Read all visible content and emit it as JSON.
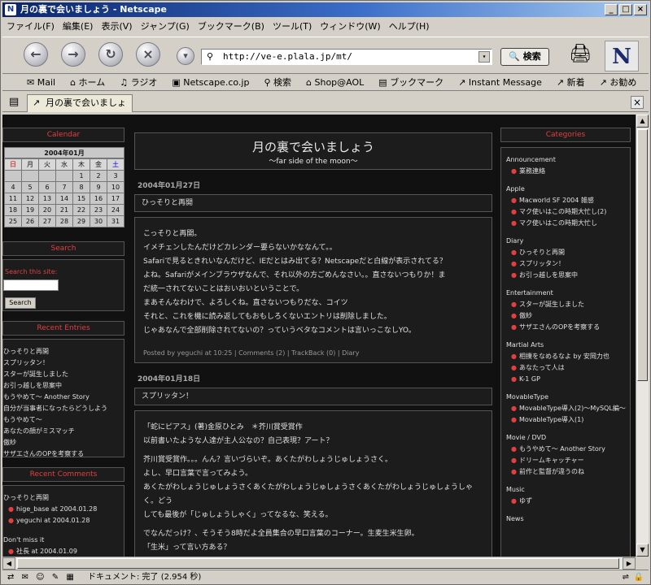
{
  "window": {
    "title": "月の裏で会いましょう - Netscape"
  },
  "menu": [
    "ファイル(F)",
    "編集(E)",
    "表示(V)",
    "ジャンプ(G)",
    "ブックマーク(B)",
    "ツール(T)",
    "ウィンドウ(W)",
    "ヘルプ(H)"
  ],
  "nav": {
    "url": "http://ve-e.plala.jp/mt/",
    "search_label": "検索"
  },
  "bookmarks": [
    "Mail",
    "ホーム",
    "ラジオ",
    "Netscape.co.jp",
    "検索",
    "Shop@AOL",
    "ブックマーク",
    "Instant Message",
    "新着",
    "お勧め"
  ],
  "tab": {
    "label": "月の裏で会いましょう"
  },
  "blog": {
    "title": "月の裏で会いましょう",
    "subtitle": "〜far side of the moon〜",
    "calendar": {
      "heading": "Calendar",
      "month": "2004年01月",
      "weekdays": [
        "日",
        "月",
        "火",
        "水",
        "木",
        "金",
        "土"
      ],
      "rows": [
        [
          "",
          "",
          "",
          "",
          "1",
          "2",
          "3"
        ],
        [
          "4",
          "5",
          "6",
          "7",
          "8",
          "9",
          "10"
        ],
        [
          "11",
          "12",
          "13",
          "14",
          "15",
          "16",
          "17"
        ],
        [
          "18",
          "19",
          "20",
          "21",
          "22",
          "23",
          "24"
        ],
        [
          "25",
          "26",
          "27",
          "28",
          "29",
          "30",
          "31"
        ]
      ]
    },
    "search": {
      "heading": "Search",
      "label": "Search this site:",
      "button": "Search"
    },
    "recent_entries": {
      "heading": "Recent Entries",
      "items": [
        "ひっそりと再開",
        "スプリッタン！",
        "スターが誕生しました",
        "お引っ越しを思案中",
        "もうやめて〜 Another Story",
        "自分が当事者になったらどうしよう",
        "もうやめて〜",
        "あなたの顔がミスマッチ",
        "傲紗",
        "サザエさんのOPを考察する"
      ]
    },
    "recent_comments": {
      "heading": "Recent Comments",
      "groups": [
        {
          "title": "ひっそりと再開",
          "items": [
            "hige_base  at 2004.01.28",
            "yeguchi  at 2004.01.28"
          ]
        },
        {
          "title": "Don't miss it",
          "items": [
            "社長  at 2004.01.09"
          ]
        }
      ]
    },
    "posts": [
      {
        "date": "2004年01月27日",
        "title": "ひっそりと再開",
        "lines": [
          "こっそりと再開。",
          "イメチェンしたんだけどカレンダー要らないかななんて。。",
          "Safariで見るときれいなんだけど、IEだとはみ出てる？Netscapeだと白線が表示されてる？",
          "よね。Safariがメインブラウザなんで、それ以外の方ごめんなさい。。直さないつもりか！ま",
          "だ統一されてないことはおいおいということで。",
          "まあそんなわけで、よろしくね。直さないつもりだな、コイツ",
          "それと、これを機に読み返してもおもしろくないエントリは削除しました。",
          "じゃあなんで全部削除されてないの？っていうベタなコメントは言いっこなしYO。"
        ],
        "footer": "Posted by yeguchi at 10:25 | Comments (2) | TrackBack (0) | Diary"
      },
      {
        "date": "2004年01月18日",
        "title": "スプリッタン！",
        "lines": [
          "「蛇にピアス」(著)金原ひとみ　＊芥川賞受賞作",
          "以前書いたような人達が主人公なの？自己表現？アート？",
          "",
          "芥川賞受賞作。。。んん？言いづらいぞ。あくたがわしょうじゅしょうさく。",
          "よし、早口言葉で言ってみよう。",
          "あくたがわしょうじゅしょうさくあくたがわしょうじゅしょうさくあくたがわしょうじゅしょうしゃく。どう",
          "しても最後が「じゅしょうしゃく」ってなるな、笑える。",
          "",
          "でなんだっけ？、そうそう8時だよ全員集合の早口言葉のコーナー。生麦生米生卵。",
          "「生米」って言い方ある？"
        ]
      }
    ],
    "categories": {
      "heading": "Categories",
      "groups": [
        {
          "name": "Announcement",
          "items": [
            "業務連絡"
          ]
        },
        {
          "name": "Apple",
          "items": [
            "Macworld SF 2004 雑感",
            "マク使いはこの時期大忙し(2)",
            "マク使いはこの時期大忙し"
          ]
        },
        {
          "name": "Diary",
          "items": [
            "ひっそりと再開",
            "スプリッタン！",
            "お引っ越しを思案中"
          ]
        },
        {
          "name": "Entertainment",
          "items": [
            "スターが誕生しました",
            "傲紗",
            "サザエさんのOPを考察する"
          ]
        },
        {
          "name": "Martial Arts",
          "items": [
            "相撲をなめるなよ by 安岡力也",
            "あなたって人は",
            "K-1 GP"
          ]
        },
        {
          "name": "MovableType",
          "items": [
            "MovableType導入(2)〜MySQL編〜",
            "MovableType導入(1)"
          ]
        },
        {
          "name": "Movie / DVD",
          "items": [
            "もうやめて〜 Another Story",
            "ドリームキャッチャー",
            "前作と監督が違うのね"
          ]
        },
        {
          "name": "Music",
          "items": [
            "ゆず"
          ]
        },
        {
          "name": "News",
          "items": []
        }
      ]
    }
  },
  "status": {
    "text": "ドキュメント: 完了 (2.954 秒)"
  },
  "colors": {
    "accent_red": "#e04040",
    "page_bg": "#111111",
    "box_bg": "#1c1c1c",
    "title_bar": "#0a246a"
  }
}
